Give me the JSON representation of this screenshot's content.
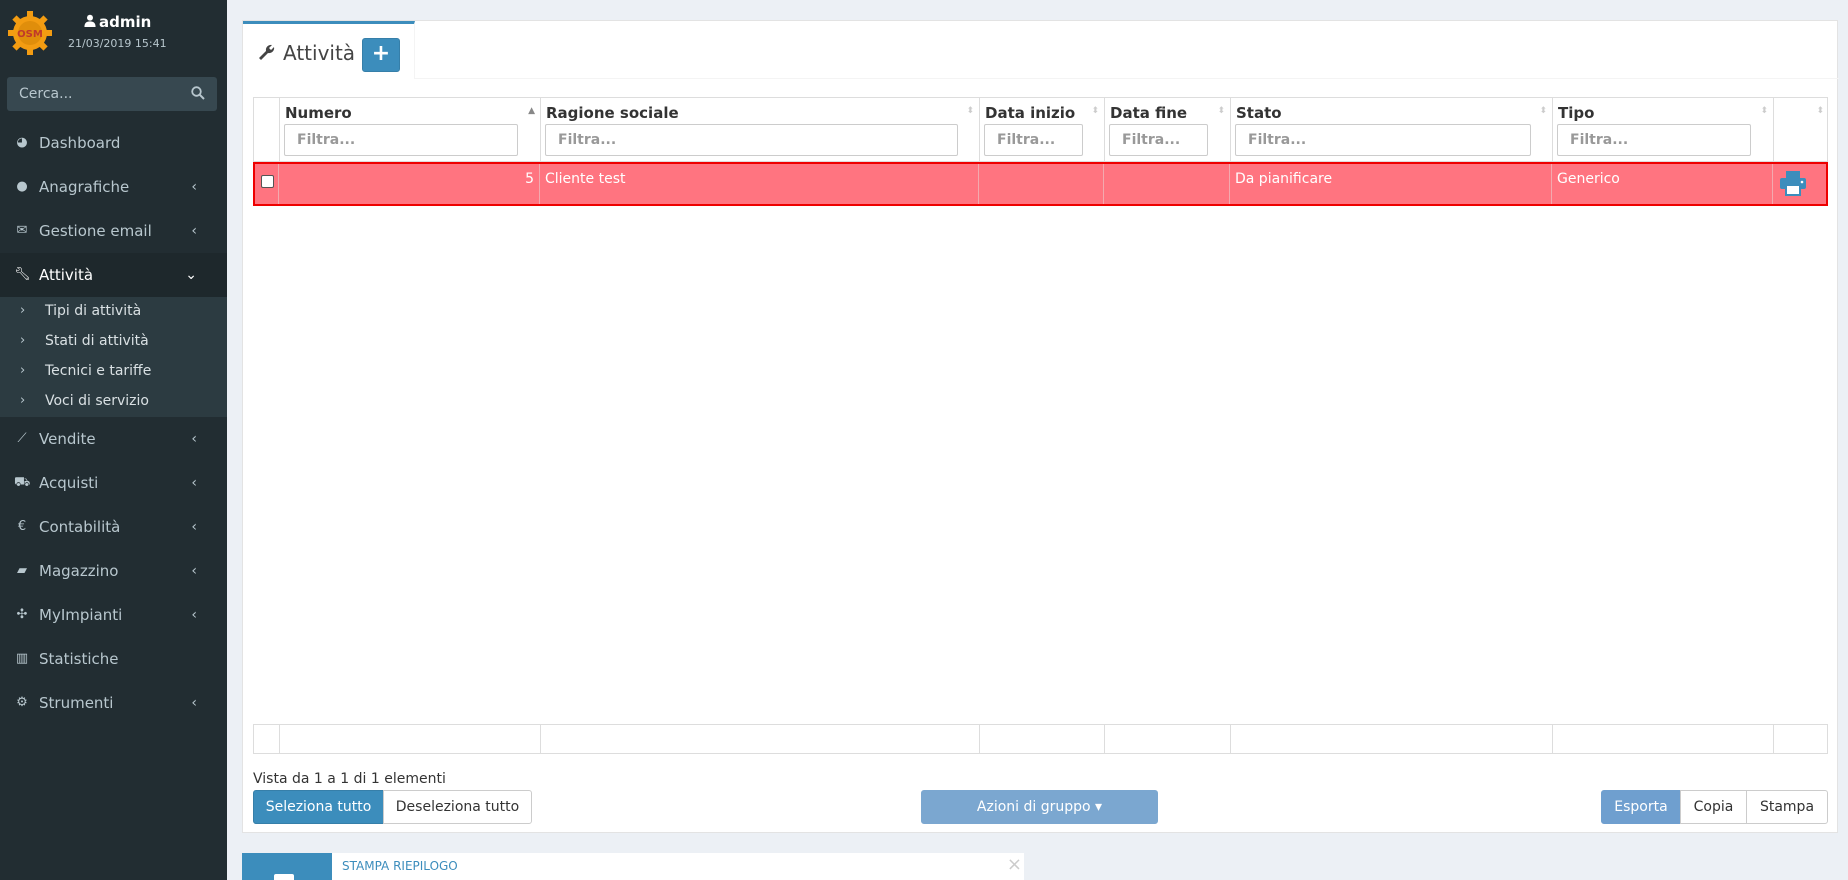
{
  "colors": {
    "accent": "#3c8dbc",
    "sidebar_bg": "#222d32",
    "row_highlight": "#ff7480",
    "row_border": "#ee0000",
    "logo_orange": "#f39c12"
  },
  "user": {
    "name": "admin",
    "datetime": "21/03/2019 15:41"
  },
  "search": {
    "placeholder": "Cerca..."
  },
  "sidebar": {
    "items": [
      {
        "label": "Dashboard",
        "icon": "dashboard-icon"
      },
      {
        "label": "Anagrafiche",
        "icon": "users-icon"
      },
      {
        "label": "Gestione email",
        "icon": "envelope-icon"
      },
      {
        "label": "Attività",
        "icon": "wrench-icon",
        "expanded": true
      },
      {
        "label": "Vendite",
        "icon": "line-chart-icon"
      },
      {
        "label": "Acquisti",
        "icon": "cart-icon"
      },
      {
        "label": "Contabilità",
        "icon": "euro-icon"
      },
      {
        "label": "Magazzino",
        "icon": "truck-icon"
      },
      {
        "label": "MyImpianti",
        "icon": "puzzle-icon"
      },
      {
        "label": "Statistiche",
        "icon": "bar-chart-icon"
      },
      {
        "label": "Strumenti",
        "icon": "gear-icon"
      }
    ],
    "subitems": [
      "Tipi di attività",
      "Stati di attività",
      "Tecnici e tariffe",
      "Voci di servizio"
    ]
  },
  "tab": {
    "title": "Attività",
    "add_label": "+"
  },
  "table": {
    "headers": [
      "Numero",
      "Ragione sociale",
      "Data inizio",
      "Data fine",
      "Stato",
      "Tipo"
    ],
    "filter_placeholder": "Filtra...",
    "rows": [
      {
        "numero": "5",
        "ragione_sociale": "Cliente test",
        "data_inizio": "",
        "data_fine": "",
        "stato": "Da pianificare",
        "tipo": "Generico"
      }
    ]
  },
  "footer": {
    "info": "Vista da 1 a 1 di 1 elementi",
    "select_all": "Seleziona tutto",
    "deselect_all": "Deseleziona tutto",
    "group_actions": "Azioni di gruppo ▾",
    "export": "Esporta",
    "copy": "Copia",
    "print": "Stampa"
  },
  "widget": {
    "title": "STAMPA RIEPILOGO",
    "close": "×"
  }
}
